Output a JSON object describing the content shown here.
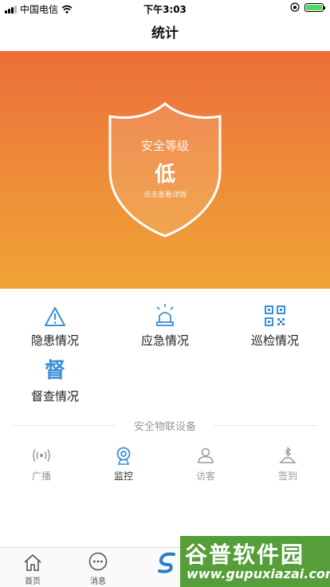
{
  "status_bar": {
    "carrier": "中国电信",
    "time": "下午3:03"
  },
  "nav": {
    "title": "统计"
  },
  "hero": {
    "title": "安全等级",
    "level": "低",
    "hint": "点击查看详情"
  },
  "grid": [
    {
      "label": "隐患情况",
      "icon": "warning-triangle-icon"
    },
    {
      "label": "应急情况",
      "icon": "alarm-light-icon"
    },
    {
      "label": "巡检情况",
      "icon": "qr-code-icon"
    },
    {
      "label": "督查情况",
      "icon": "supervise-du-icon",
      "glyph": "督"
    }
  ],
  "devices": {
    "title": "安全物联设备",
    "items": [
      {
        "label": "广播",
        "icon": "broadcast-icon"
      },
      {
        "label": "监控",
        "icon": "camera-icon"
      },
      {
        "label": "访客",
        "icon": "visitor-icon"
      },
      {
        "label": "签到",
        "icon": "bluetooth-checkin-icon"
      }
    ]
  },
  "tabs": [
    {
      "label": "首页",
      "icon": "home-icon"
    },
    {
      "label": "消息",
      "icon": "message-icon"
    }
  ],
  "watermark": {
    "logo": "谷普软件园",
    "url": "www.gupuxiazai.com"
  },
  "colors": {
    "accent_blue": "#3a8fd6",
    "hero_top": "#ec6e3a",
    "hero_bottom": "#f0a336"
  }
}
